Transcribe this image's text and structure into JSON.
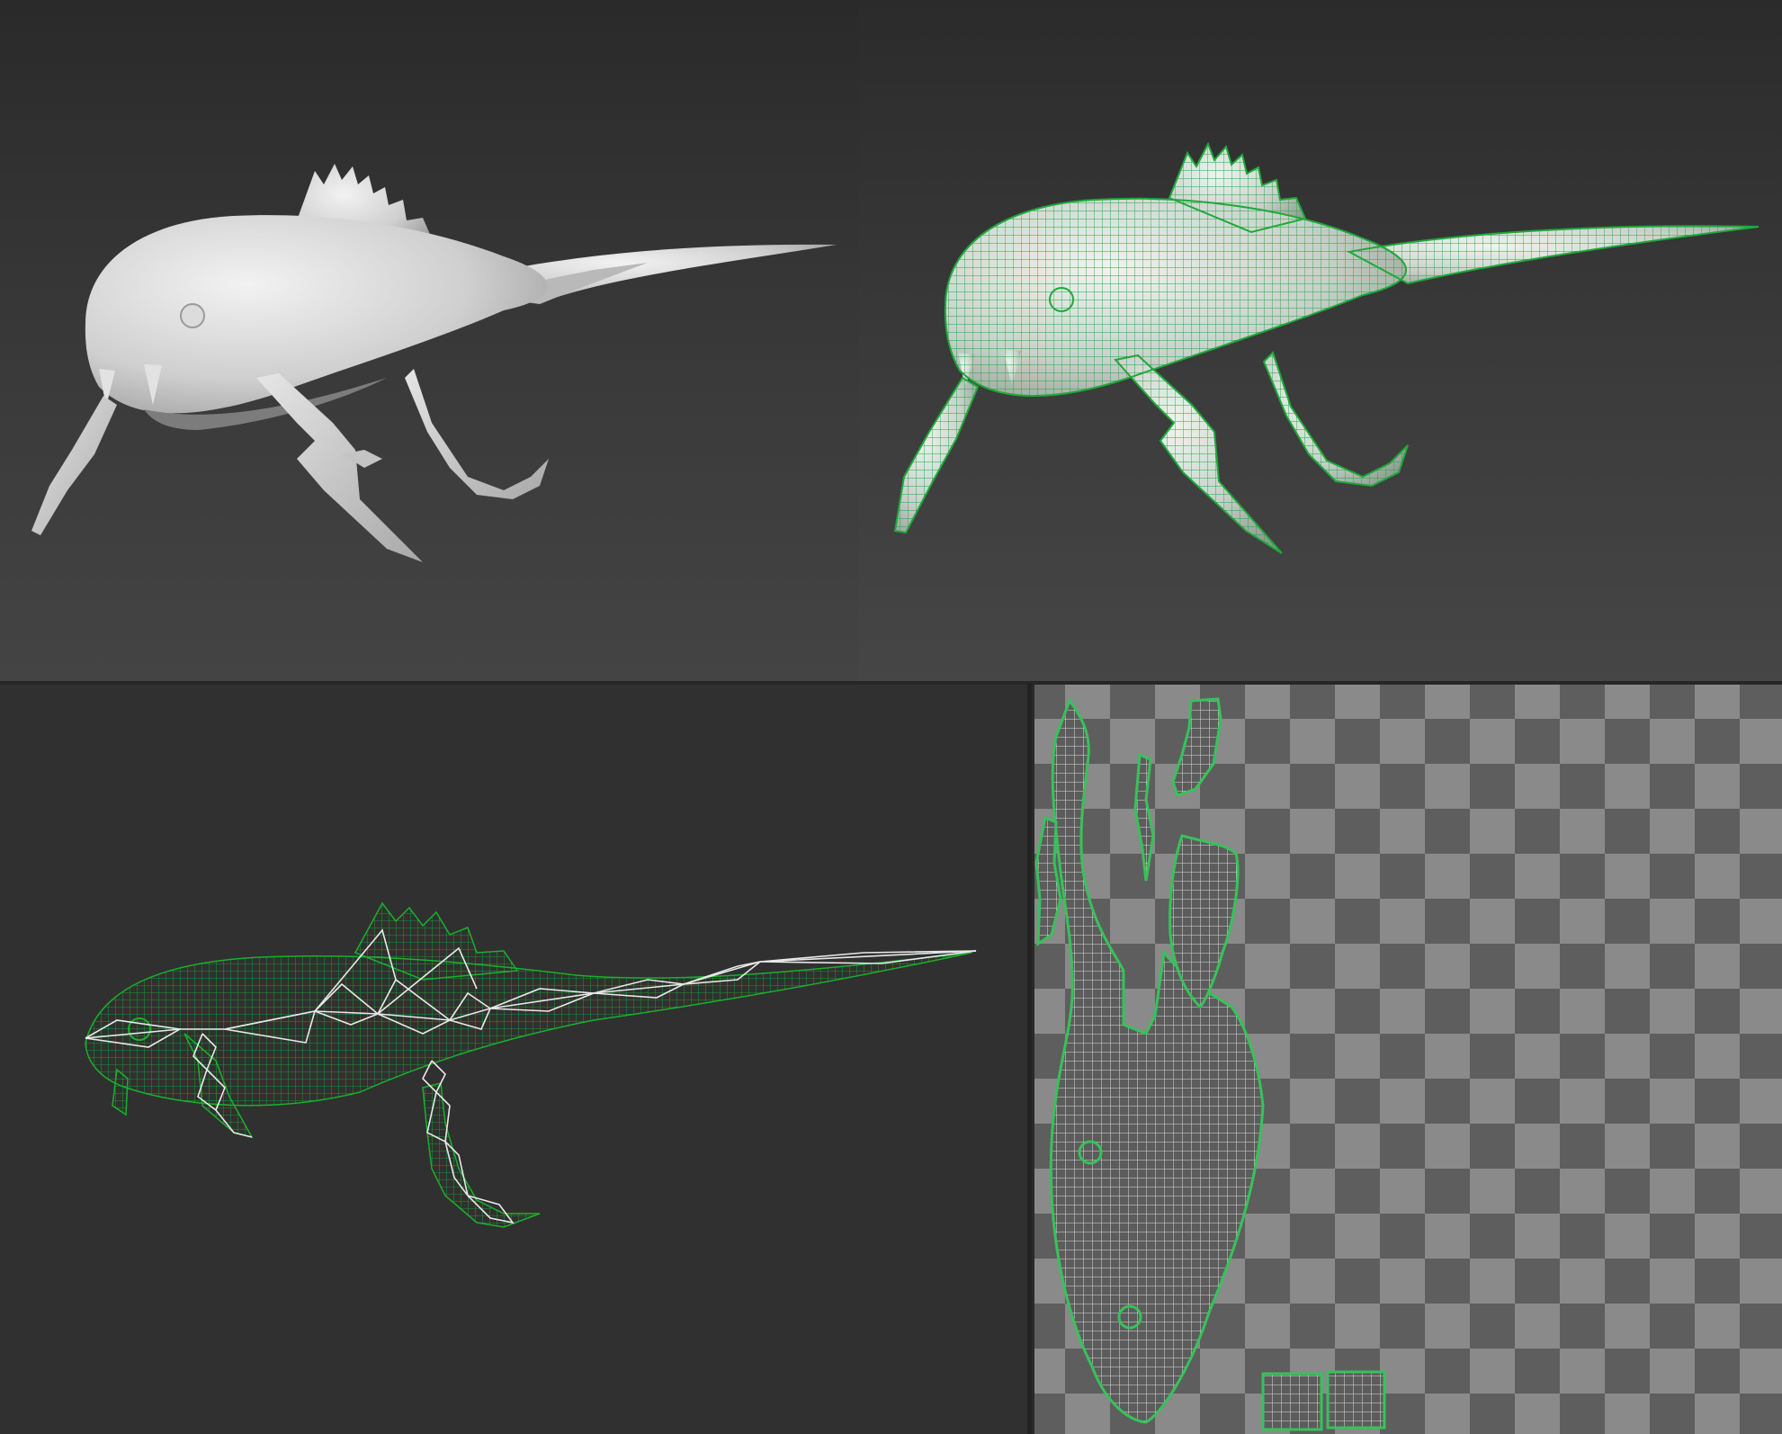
{
  "viewports": [
    {
      "id": "shaded",
      "mode": "shaded"
    },
    {
      "id": "wire",
      "mode": "shaded-wireframe",
      "wire_color": "#1fa83a",
      "surface_color": "#cfd8d2"
    },
    {
      "id": "rig",
      "mode": "wireframe-with-bones",
      "wire_color": "#19b02c",
      "bone_color": "#e8e8e8"
    },
    {
      "id": "uv",
      "mode": "uv-layout",
      "checker_light": "#8a8a8a",
      "checker_dark": "#5e5e5e",
      "border_color": "#37c25a"
    }
  ]
}
